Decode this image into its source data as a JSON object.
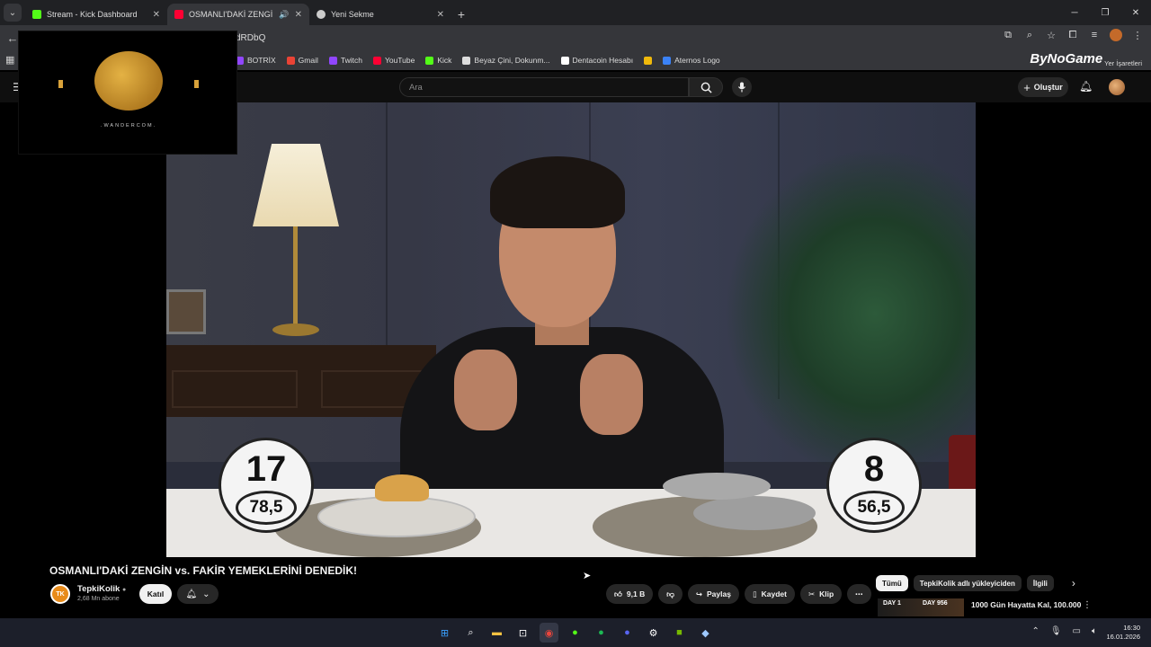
{
  "browser": {
    "tabs": [
      {
        "label": "Stream - Kick Dashboard",
        "favicon_color": "#53fc18"
      },
      {
        "label": "OSMANLI'DAKİ ZENGİN vs.",
        "favicon_color": "#ff0033"
      },
      {
        "label": "Yeni Sekme",
        "favicon_color": "#cccccc"
      }
    ],
    "url": "dRDbQ",
    "bookmarks": [
      {
        "label": "BOTRİX",
        "color": "#9146ff"
      },
      {
        "label": "Gmail",
        "color": "#ea4335"
      },
      {
        "label": "Twitch",
        "color": "#9146ff"
      },
      {
        "label": "YouTube",
        "color": "#ff0033"
      },
      {
        "label": "Kick",
        "color": "#53fc18"
      },
      {
        "label": "Beyaz Çini, Dokunm...",
        "color": "#dddddd"
      },
      {
        "label": "Dentacoin Hesabı",
        "color": "#ffffff"
      },
      {
        "label": "",
        "color": "#f0b90b"
      },
      {
        "label": "Aternos Logo",
        "color": "#3b82f6"
      }
    ],
    "bookmarks_right": "Yer İşaretleri",
    "brand_logo": "ByNoGame"
  },
  "youtube": {
    "search_placeholder": "Ara",
    "create_label": "Oluştur"
  },
  "overlay": {
    "watermark": ".WANDERCOM."
  },
  "video": {
    "title": "OSMANLI'DAKİ ZENGİN vs. FAKİR YEMEKLERİNİ DENEDİK!",
    "score_left_big": "17",
    "score_left_small": "78,5",
    "score_right_big": "8",
    "score_right_small": "56,5"
  },
  "channel": {
    "name": "TepkiKolik",
    "avatar_text": "TK",
    "subscribers": "2,68 Mn abone",
    "join_label": "Katıl"
  },
  "actions": {
    "likes": "9,1 B",
    "share": "Paylaş",
    "save": "Kaydet",
    "clip": "Klip"
  },
  "chips": [
    "Tümü",
    "TepkiKolik adlı yükleyiciden",
    "İlgili"
  ],
  "recommendation": {
    "thumb_left": "DAY 1",
    "thumb_right": "DAY 956",
    "title": "1000 Gün Hayatta Kal, 100.000"
  },
  "clock": {
    "time": "16:30",
    "date": "16.01.2026"
  }
}
